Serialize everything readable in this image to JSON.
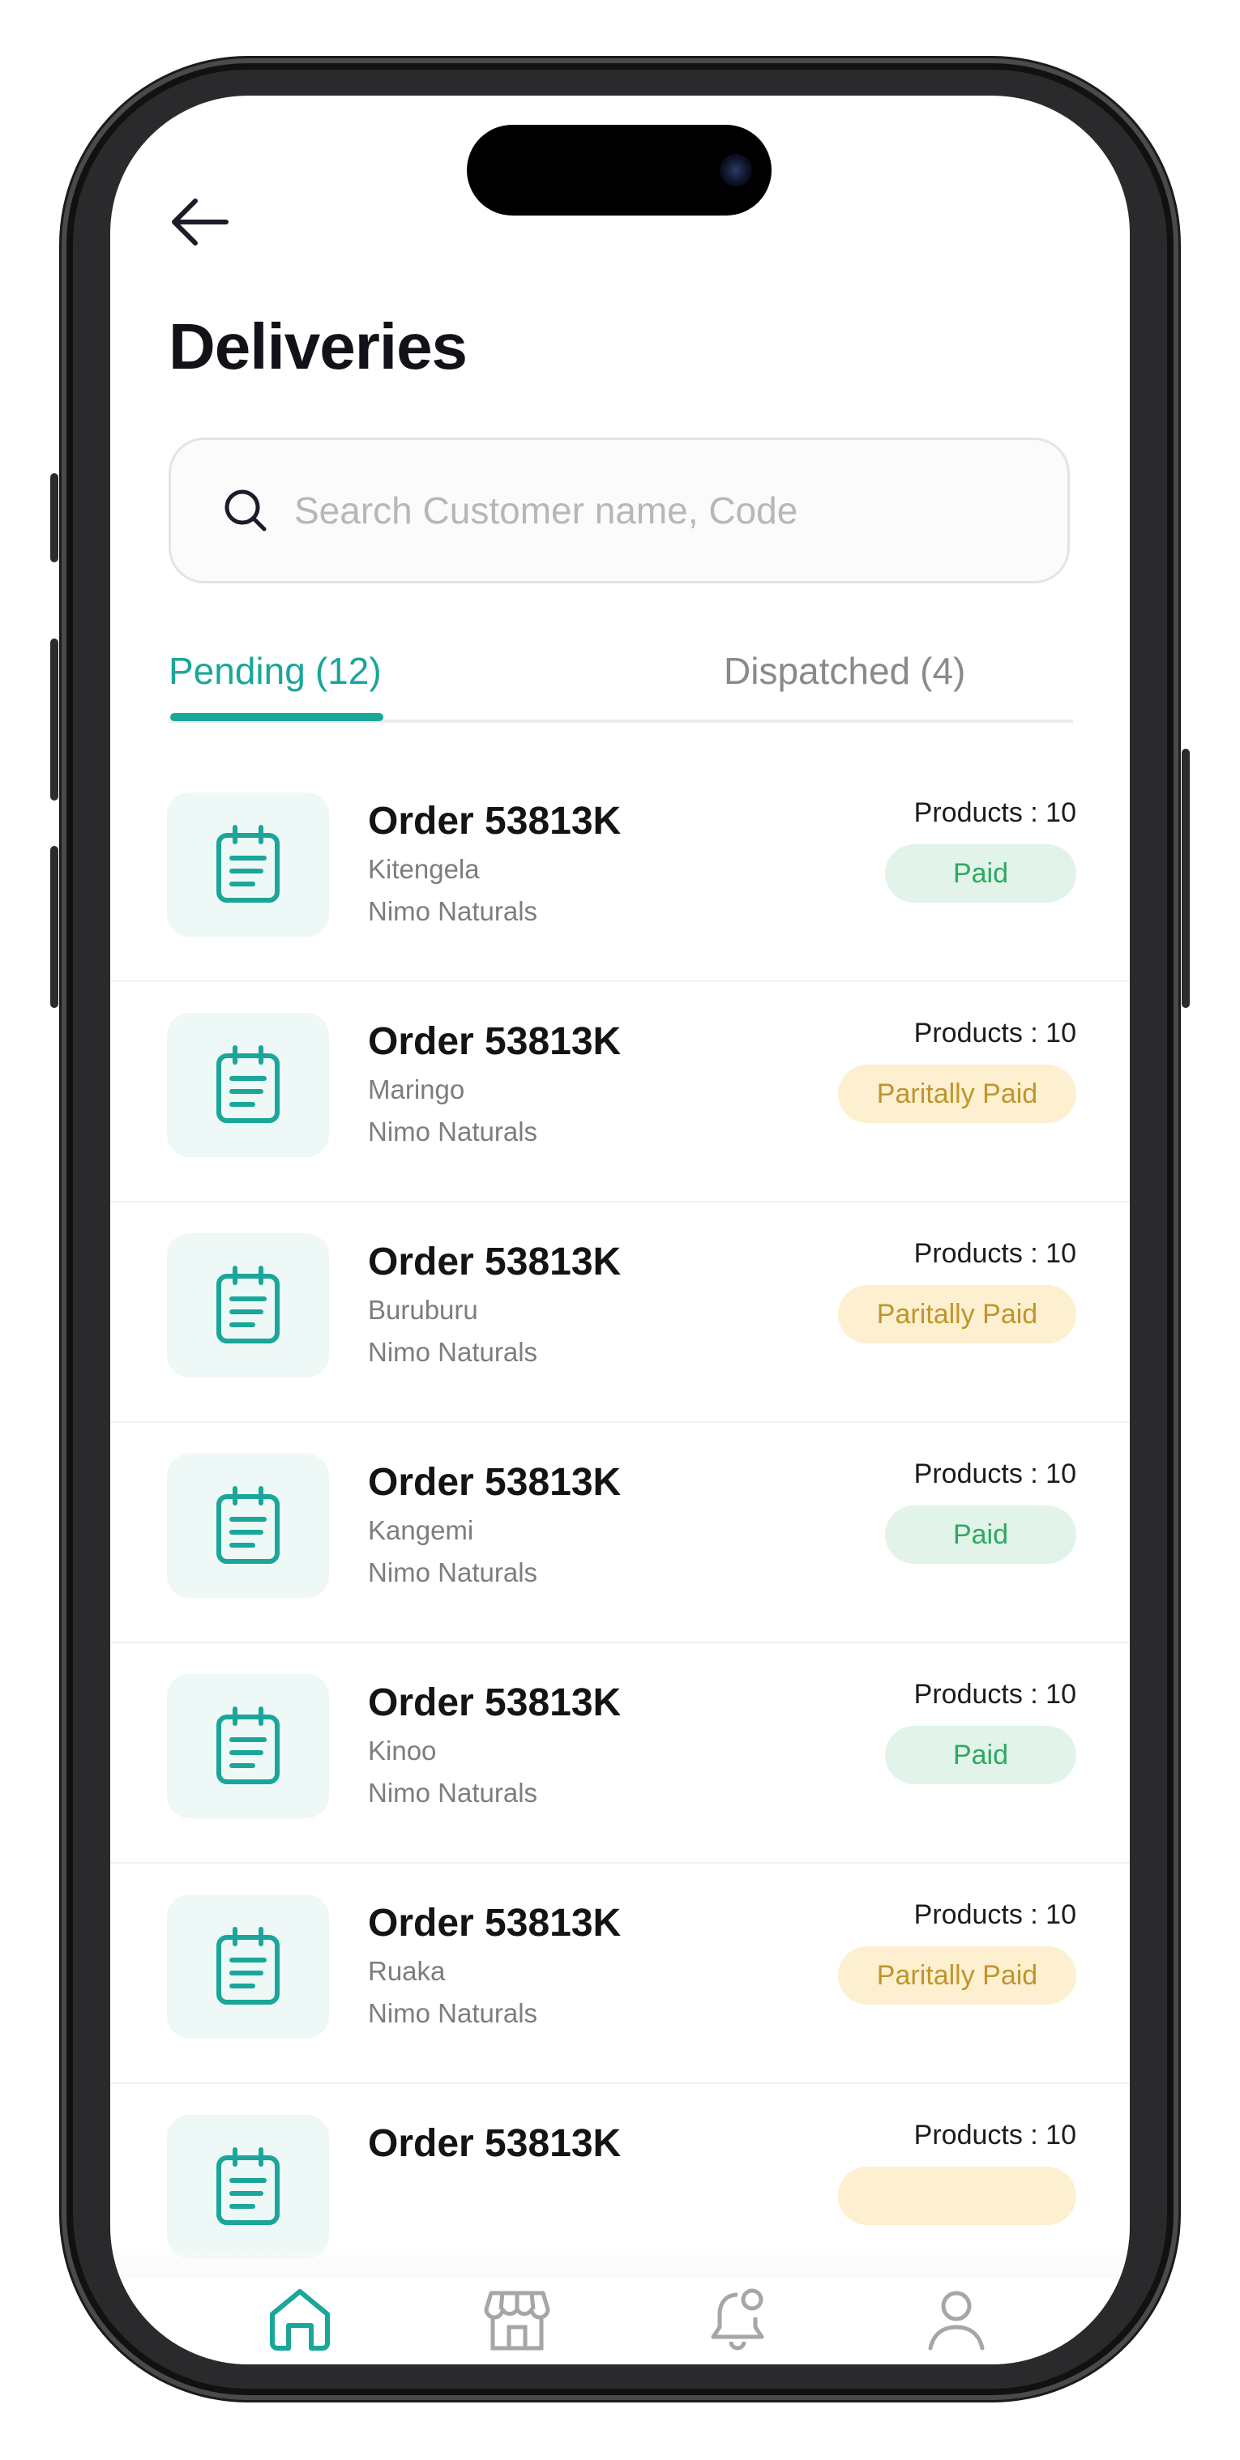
{
  "header": {
    "back_icon": "arrow-left-icon",
    "title": "Deliveries"
  },
  "search": {
    "icon": "search-icon",
    "placeholder": "Search Customer name, Code",
    "value": ""
  },
  "tabs": [
    {
      "label": "Pending",
      "count": "(12)",
      "active": true
    },
    {
      "label": "Dispatched",
      "count": "(4)",
      "active": false
    }
  ],
  "orders": [
    {
      "title": "Order 53813K",
      "location": "Kitengela",
      "vendor": "Nimo Naturals",
      "products": "Products : 10",
      "status": "Paid",
      "status_type": "paid"
    },
    {
      "title": "Order 53813K",
      "location": "Maringo",
      "vendor": "Nimo Naturals",
      "products": "Products : 10",
      "status": "Paritally Paid",
      "status_type": "partial"
    },
    {
      "title": "Order 53813K",
      "location": "Buruburu",
      "vendor": "Nimo Naturals",
      "products": "Products : 10",
      "status": "Paritally Paid",
      "status_type": "partial"
    },
    {
      "title": "Order 53813K",
      "location": "Kangemi",
      "vendor": "Nimo Naturals",
      "products": "Products : 10",
      "status": "Paid",
      "status_type": "paid"
    },
    {
      "title": "Order 53813K",
      "location": "Kinoo",
      "vendor": "Nimo Naturals",
      "products": "Products : 10",
      "status": "Paid",
      "status_type": "paid"
    },
    {
      "title": "Order 53813K",
      "location": "Ruaka",
      "vendor": "Nimo Naturals",
      "products": "Products : 10",
      "status": "Paritally Paid",
      "status_type": "partial"
    },
    {
      "title": "Order 53813K",
      "location": "",
      "vendor": "",
      "products": "Products : 10",
      "status": "",
      "status_type": "partial"
    }
  ],
  "bottom_nav": [
    {
      "name": "home-icon",
      "active": true
    },
    {
      "name": "store-icon",
      "active": false
    },
    {
      "name": "notification-bell-icon",
      "active": false
    },
    {
      "name": "profile-icon",
      "active": false
    }
  ],
  "colors": {
    "accent": "#1aa69a",
    "paid_bg": "#e2f4ea",
    "paid_text": "#2fa860",
    "partial_bg": "#fdf0d0",
    "partial_text": "#c0952c",
    "inactive_icon": "#a6a6a6"
  }
}
